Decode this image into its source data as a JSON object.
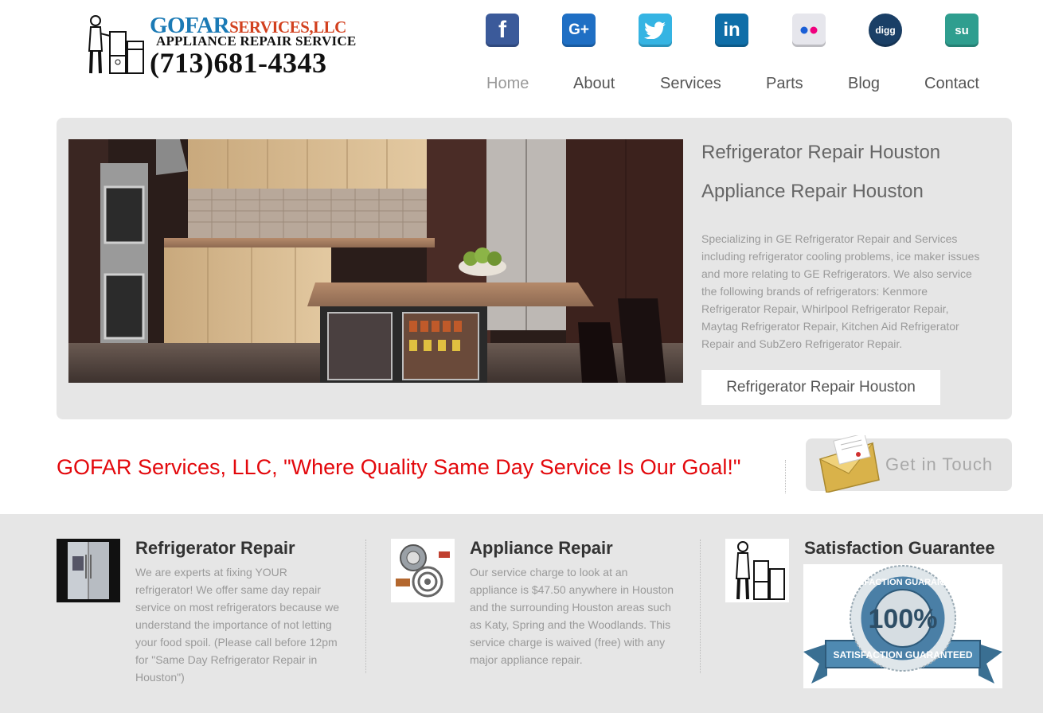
{
  "logo": {
    "name": "GOFAR",
    "name_suffix": "SERVICES,LLC",
    "subtitle": "APPLIANCE REPAIR SERVICE",
    "phone": "(713)681-4343"
  },
  "social": [
    {
      "name": "facebook",
      "glyph": "f"
    },
    {
      "name": "google-plus",
      "glyph": "G+"
    },
    {
      "name": "twitter",
      "glyph": ""
    },
    {
      "name": "linkedin",
      "glyph": "in"
    },
    {
      "name": "flickr",
      "glyph": ""
    },
    {
      "name": "digg",
      "glyph": "digg"
    },
    {
      "name": "stumbleupon",
      "glyph": "su"
    }
  ],
  "nav": {
    "items": [
      "Home",
      "About",
      "Services",
      "Parts",
      "Blog",
      "Contact"
    ],
    "active": "Home"
  },
  "hero": {
    "title1": "Refrigerator Repair Houston",
    "title2": "Appliance Repair Houston",
    "text": "Specializing in GE Refrigerator Repair and Services including refrigerator cooling problems, ice maker issues and more relating to GE Refrigerators. We also service the following brands of refrigerators: Kenmore Refrigerator Repair, Whirlpool Refrigerator Repair, Maytag Refrigerator Repair, Kitchen Aid Refrigerator Repair and SubZero Refrigerator Repair.",
    "button": "Refrigerator Repair Houston"
  },
  "tagline": "GOFAR Services, LLC, \"Where Quality Same Day Service Is Our Goal!\"",
  "get_in_touch": "Get in Touch",
  "features": [
    {
      "title": "Refrigerator Repair",
      "text": "We are experts at fixing YOUR refrigerator! We offer same day repair service on most refrigerators because we understand the importance of not letting your food spoil. (Please call before 12pm for \"Same Day Refrigerator Repair in Houston\")"
    },
    {
      "title": "Appliance Repair",
      "text": "Our service charge to look at an appliance is $47.50 anywhere in Houston and the surrounding Houston areas such as Katy, Spring and the Woodlands. This service charge is waived (free) with any major appliance repair."
    },
    {
      "title": "Satisfaction Guarantee",
      "text": ""
    }
  ],
  "badge": {
    "percent": "100%",
    "ring_text": "SATISFACTION GUARANTEED",
    "ribbon": "SATISFACTION GUARANTEED"
  },
  "colors": {
    "tagline": "#e3080c",
    "panel": "#e6e6e6",
    "logo_blue": "#1b7ab5",
    "logo_red": "#d2401e"
  }
}
